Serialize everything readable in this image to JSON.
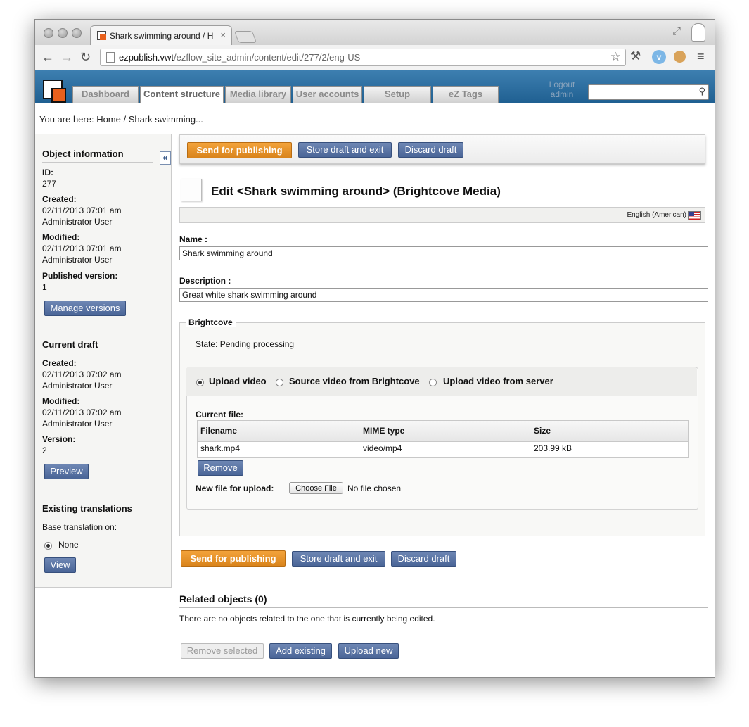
{
  "browser": {
    "tab_title": "Shark swimming around / H",
    "tab_close": "×",
    "url_host": "ezpublish.vwt",
    "url_path": "/ezflow_site_admin/content/edit/277/2/eng-US"
  },
  "header": {
    "nav": [
      "Dashboard",
      "Content structure",
      "Media library",
      "User accounts",
      "Setup",
      "eZ Tags"
    ],
    "logout_line1": "Logout",
    "logout_line2": "admin"
  },
  "breadcrumb": "You are here: Home / Shark swimming...",
  "sidebar": {
    "object_info_title": "Object information",
    "id_label": "ID:",
    "id_value": "277",
    "created_label": "Created:",
    "created_date": "02/11/2013 07:01 am",
    "created_user": "Administrator User",
    "modified_label": "Modified:",
    "modified_date": "02/11/2013 07:01 am",
    "modified_user": "Administrator User",
    "published_label": "Published version:",
    "published_value": "1",
    "manage_versions": "Manage versions",
    "draft_title": "Current draft",
    "draft_created_label": "Created:",
    "draft_created_date": "02/11/2013 07:02 am",
    "draft_created_user": "Administrator User",
    "draft_modified_label": "Modified:",
    "draft_modified_date": "02/11/2013 07:02 am",
    "draft_modified_user": "Administrator User",
    "version_label": "Version:",
    "version_value": "2",
    "preview": "Preview",
    "translations_title": "Existing translations",
    "base_translation": "Base translation on:",
    "none_option": "None",
    "view": "View",
    "collapse": "«"
  },
  "actions": {
    "send": "Send for publishing",
    "store": "Store draft and exit",
    "discard": "Discard draft"
  },
  "editor": {
    "title": "Edit <Shark swimming around> (Brightcove Media)",
    "language": "English (American)",
    "name_label": "Name :",
    "name_value": "Shark swimming around",
    "description_label": "Description :",
    "description_value": "Great white shark swimming around"
  },
  "brightcove": {
    "legend": "Brightcove",
    "state": "State: Pending processing",
    "options": [
      "Upload video",
      "Source video from Brightcove",
      "Upload video from server"
    ],
    "current_file_label": "Current file:",
    "columns": [
      "Filename",
      "MIME type",
      "Size"
    ],
    "file": {
      "filename": "shark.mp4",
      "mime": "video/mp4",
      "size": "203.99 kB"
    },
    "remove": "Remove",
    "new_file_label": "New file for upload:",
    "choose_file": "Choose File",
    "no_file": "No file chosen"
  },
  "related": {
    "title": "Related objects (0)",
    "empty_text": "There are no objects related to the one that is currently being edited.",
    "remove_selected": "Remove selected",
    "add_existing": "Add existing",
    "upload_new": "Upload new"
  },
  "colors": {
    "header_blue": "#2a6b9c",
    "orange_button": "#e8921f",
    "blue_button": "#4f6a9c",
    "logo_orange": "#e8601c"
  }
}
